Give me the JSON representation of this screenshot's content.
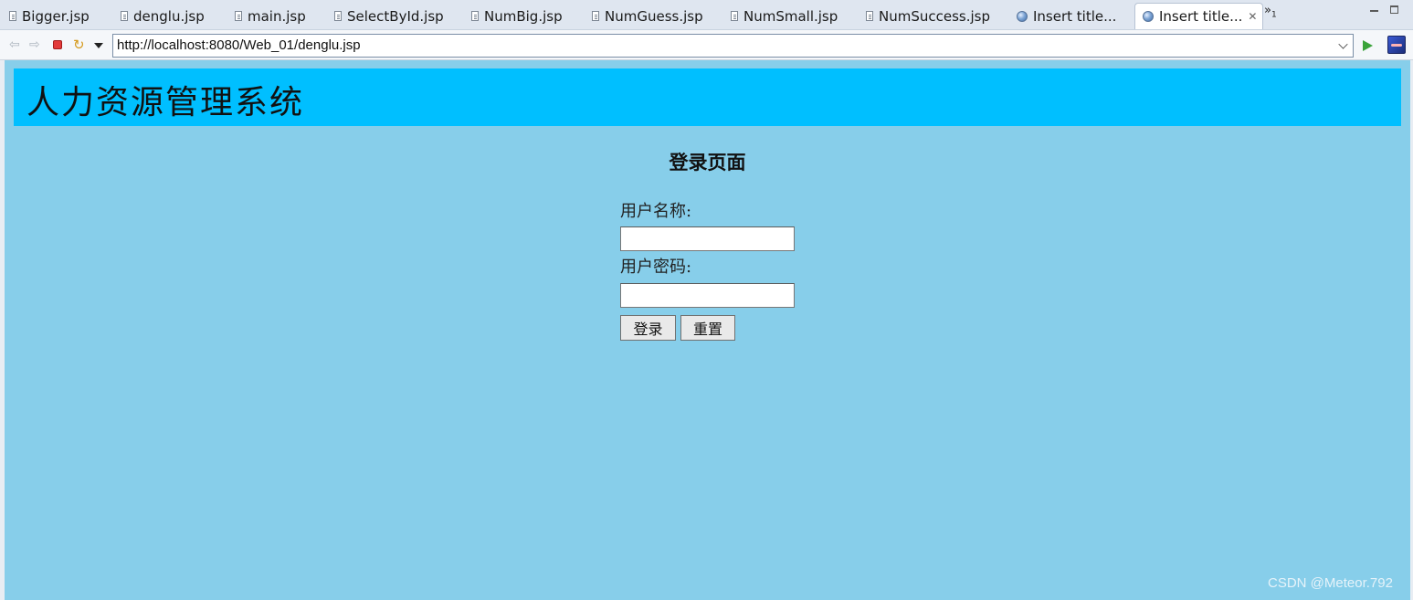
{
  "tabs": [
    {
      "label": "Bigger.jsp",
      "icon": "file-icon"
    },
    {
      "label": "denglu.jsp",
      "icon": "file-icon"
    },
    {
      "label": "main.jsp",
      "icon": "file-icon"
    },
    {
      "label": "SelectById.jsp",
      "icon": "file-icon"
    },
    {
      "label": "NumBig.jsp",
      "icon": "file-icon"
    },
    {
      "label": "NumGuess.jsp",
      "icon": "file-icon"
    },
    {
      "label": "NumSmall.jsp",
      "icon": "file-icon"
    },
    {
      "label": "NumSuccess.jsp",
      "icon": "file-icon"
    },
    {
      "label": "Insert title...",
      "icon": "globe-icon"
    },
    {
      "label": "Insert title...",
      "icon": "globe-icon",
      "active": true
    }
  ],
  "overflow_chevron": "»",
  "overflow_count": "1",
  "toolbar": {
    "url": "http://localhost:8080/Web_01/denglu.jsp"
  },
  "page": {
    "header_title": "人力资源管理系统",
    "login_heading": "登录页面",
    "username_label": "用户名称:",
    "username_value": "",
    "password_label": "用户密码:",
    "password_value": "",
    "login_button": "登录",
    "reset_button": "重置",
    "watermark": "CSDN @Meteor.792"
  },
  "colors": {
    "page_background": "#87ceea",
    "header_background": "#00bfff"
  }
}
